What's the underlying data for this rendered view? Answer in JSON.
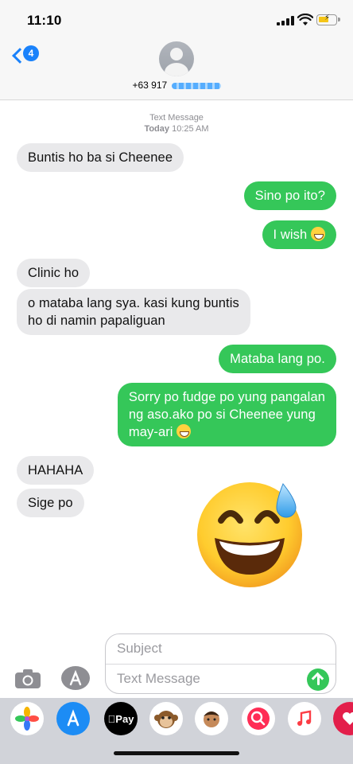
{
  "status": {
    "time": "11:10"
  },
  "header": {
    "back_count": "4",
    "contact_prefix": "+63 917"
  },
  "thread": {
    "service": "Text Message",
    "day": "Today",
    "time": "10:25 AM",
    "messages": [
      {
        "dir": "in",
        "text": "Buntis ho ba si Cheenee"
      },
      {
        "dir": "out",
        "text": "Sino po ito?"
      },
      {
        "dir": "out",
        "text": "I wish"
      },
      {
        "dir": "in",
        "text": "Clinic ho"
      },
      {
        "dir": "in",
        "text_line1": "o mataba lang sya. kasi kung buntis",
        "text_line2": "ho di namin papaliguan"
      },
      {
        "dir": "out",
        "text": "Mataba lang po."
      },
      {
        "dir": "out",
        "text_line1": "Sorry po fudge po yung pangalan",
        "text_line2": "ng aso.ako po si Cheenee yung",
        "text_line3": "may-ari"
      },
      {
        "dir": "in",
        "text": "HAHAHA"
      },
      {
        "dir": "in",
        "text": "Sige po"
      }
    ],
    "big_emoji": "grinning-face-with-sweat"
  },
  "composer": {
    "subject_placeholder": "Subject",
    "message_placeholder": "Text Message"
  },
  "app_strip": {
    "apps": [
      "photos-icon",
      "app-store-icon",
      "apple-pay-icon",
      "animoji-icon",
      "memoji-icon",
      "image-search-icon",
      "music-icon",
      "digital-touch-icon"
    ],
    "apple_pay_label": "Pay"
  },
  "colors": {
    "accent": "#1a82fb",
    "outgoing": "#35c759",
    "incoming": "#e9e9eb"
  }
}
